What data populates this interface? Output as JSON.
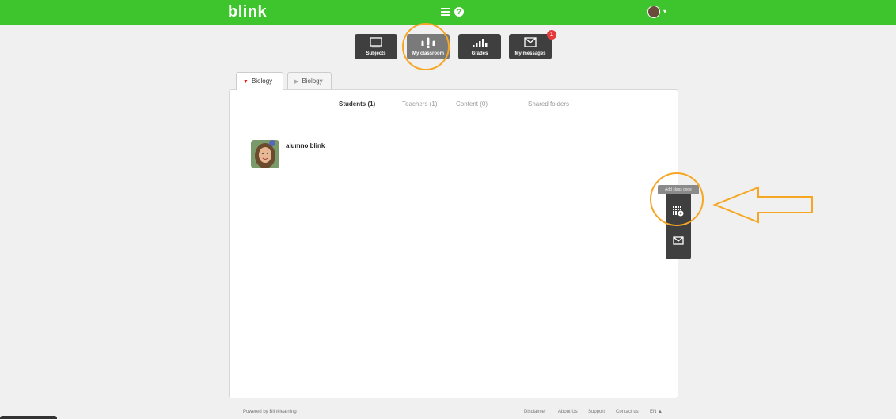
{
  "header": {
    "logo": "blink",
    "help_icon": "?"
  },
  "nav": [
    {
      "label": "Subjects",
      "icon": "book-icon"
    },
    {
      "label": "My classroom",
      "icon": "classroom-icon"
    },
    {
      "label": "Grades",
      "icon": "bar-chart-icon"
    },
    {
      "label": "My messages",
      "icon": "envelope-icon",
      "badge": "1"
    }
  ],
  "tabs": [
    {
      "label": "Biology"
    },
    {
      "label": "Biology"
    }
  ],
  "subtabs": {
    "students": "Students (1)",
    "teachers": "Teachers (1)",
    "content": "Content (0)",
    "shared": "Shared folders"
  },
  "students": [
    {
      "name": "alumno blink"
    }
  ],
  "tools": {
    "tooltip": "Add class code"
  },
  "footer": {
    "powered": "Powered by Blinklearning",
    "links": [
      "Disclaimer",
      "About Us",
      "Support",
      "Contact us"
    ],
    "lang": "EN ▲"
  },
  "colors": {
    "brand": "#3ec42c",
    "dark_button": "#3f3f3f",
    "highlight": "#f5a623",
    "badge": "#e63939"
  }
}
